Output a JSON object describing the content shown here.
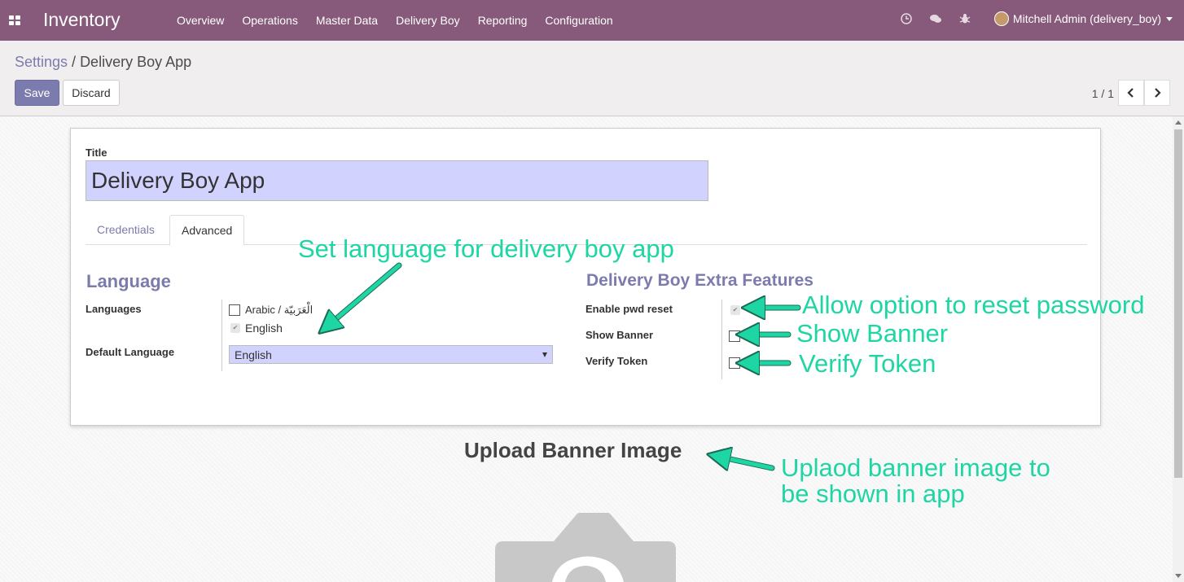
{
  "navbar": {
    "app_title": "Inventory",
    "menu": [
      "Overview",
      "Operations",
      "Master Data",
      "Delivery Boy",
      "Reporting",
      "Configuration"
    ],
    "user": "Mitchell Admin (delivery_boy)",
    "icons": [
      "clock-icon",
      "chat-icon",
      "bug-icon"
    ]
  },
  "breadcrumb": {
    "parent": "Settings",
    "separator": " / ",
    "current": "Delivery Boy App"
  },
  "actions": {
    "save": "Save",
    "discard": "Discard"
  },
  "pager": {
    "text": "1 / 1"
  },
  "form": {
    "title_label": "Title",
    "title_value": "Delivery Boy App",
    "tabs": [
      "Credentials",
      "Advanced"
    ],
    "active_tab": "Advanced",
    "language_section": {
      "title": "Language",
      "languages_label": "Languages",
      "languages": [
        {
          "label": "Arabic / الْعَرَبيّة",
          "checked": false
        },
        {
          "label": "English",
          "checked": true
        }
      ],
      "default_language_label": "Default Language",
      "default_language_value": "English"
    },
    "features_section": {
      "title": "Delivery Boy Extra Features",
      "fields": [
        {
          "label": "Enable pwd reset",
          "checked": true
        },
        {
          "label": "Show Banner",
          "checked": false
        },
        {
          "label": "Verify Token",
          "checked": false
        }
      ]
    },
    "upload_banner_title": "Upload Banner Image"
  },
  "annotations": {
    "language": "Set language for delivery boy app",
    "pwd_reset": "Allow option to reset password",
    "show_banner": "Show Banner",
    "verify_token": "Verify Token",
    "banner_line1": "Uplaod banner image to",
    "banner_line2": "be shown in app"
  },
  "colors": {
    "navbar": "#875a7b",
    "primary": "#7c7bad",
    "annotation": "#1ed6a4",
    "input_bg": "#d2d2ff"
  }
}
